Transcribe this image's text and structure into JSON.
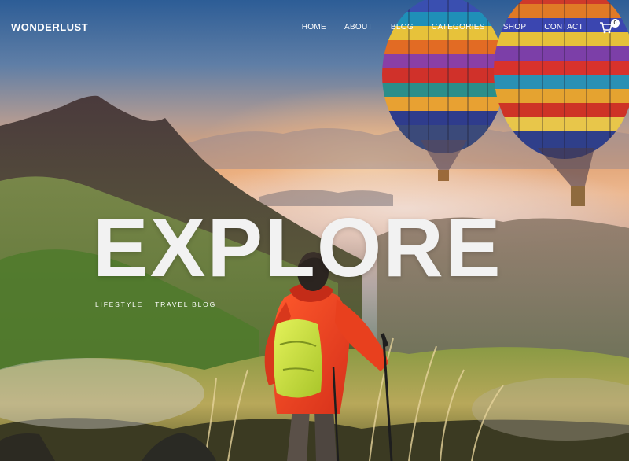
{
  "brand": {
    "logo_text": "WONDERLUST"
  },
  "nav": {
    "items": [
      {
        "label": "HOME"
      },
      {
        "label": "ABOUT"
      },
      {
        "label": "BLOG"
      },
      {
        "label": "CATEGORIES"
      },
      {
        "label": "SHOP"
      },
      {
        "label": "CONTACT"
      }
    ],
    "cart_icon": "cart-icon",
    "cart_count": "0"
  },
  "hero": {
    "headline": "EXPLORE",
    "tagline_left": "LIFESTYLE",
    "tagline_right": "TRAVEL BLOG",
    "accent_color": "#f1a53a"
  }
}
